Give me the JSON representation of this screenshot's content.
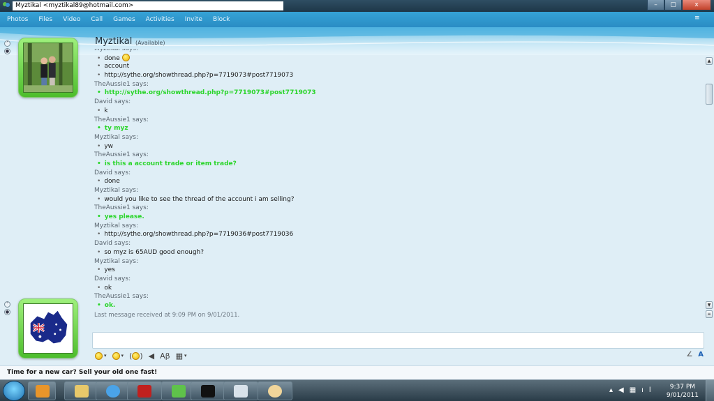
{
  "window": {
    "title": "Myztikal <myztikal89@hotmail.com>",
    "minimize": "–",
    "maximize": "▢",
    "close": "x"
  },
  "menu": {
    "items": [
      "Photos",
      "Files",
      "Video",
      "Call",
      "Games",
      "Activities",
      "Invite",
      "Block"
    ],
    "options_icon": "≡"
  },
  "contact": {
    "name": "Myztikal",
    "status": "(Available)"
  },
  "conversation": [
    {
      "kind": "speaker",
      "text": "Myztikal says:"
    },
    {
      "kind": "msg",
      "text": "done",
      "emoticon": true
    },
    {
      "kind": "msg",
      "text": "account"
    },
    {
      "kind": "msg",
      "text": "http://sythe.org/showthread.php?p=7719073#post7719073"
    },
    {
      "kind": "speaker",
      "text": "TheAussie1 says:"
    },
    {
      "kind": "msg-green",
      "text": "http://sythe.org/showthread.php?p=7719073#post7719073"
    },
    {
      "kind": "speaker",
      "text": "David says:"
    },
    {
      "kind": "msg",
      "text": "k"
    },
    {
      "kind": "speaker",
      "text": "TheAussie1 says:"
    },
    {
      "kind": "msg-green",
      "text": "ty myz"
    },
    {
      "kind": "speaker",
      "text": "Myztikal says:"
    },
    {
      "kind": "msg",
      "text": "yw"
    },
    {
      "kind": "speaker",
      "text": "TheAussie1 says:"
    },
    {
      "kind": "msg-green",
      "text": "is this a account trade or item trade?"
    },
    {
      "kind": "speaker",
      "text": "David says:"
    },
    {
      "kind": "msg",
      "text": "done"
    },
    {
      "kind": "speaker",
      "text": "Myztikal says:"
    },
    {
      "kind": "msg",
      "text": "would you like to see the thread of the account i am selling?"
    },
    {
      "kind": "speaker",
      "text": "TheAussie1 says:"
    },
    {
      "kind": "msg-green",
      "text": "yes please."
    },
    {
      "kind": "speaker",
      "text": "Myztikal says:"
    },
    {
      "kind": "msg",
      "text": "http://sythe.org/showthread.php?p=7719036#post7719036"
    },
    {
      "kind": "speaker",
      "text": "David says:"
    },
    {
      "kind": "msg",
      "text": "so myz is 65AUD good enough?"
    },
    {
      "kind": "speaker",
      "text": "Myztikal says:"
    },
    {
      "kind": "msg",
      "text": "yes"
    },
    {
      "kind": "speaker",
      "text": "David says:"
    },
    {
      "kind": "msg",
      "text": "ok"
    },
    {
      "kind": "speaker",
      "text": "TheAussie1 says:"
    },
    {
      "kind": "msg-green",
      "text": "ok."
    }
  ],
  "last_message": "Last message received at 9:09 PM on 9/01/2011.",
  "ad": {
    "text": "Time for a new car? Sell your old one fast!"
  },
  "taskbar": {
    "time": "9:37 PM",
    "date": "9/01/2011"
  },
  "colors": {
    "menubar": "#2a8cc4",
    "green_text": "#2bd52b",
    "avatar_frame": "#4dbd2c"
  }
}
